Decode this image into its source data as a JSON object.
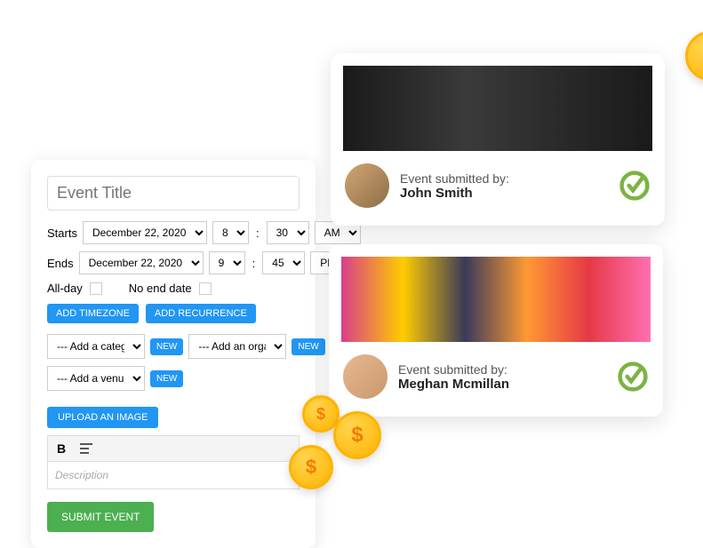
{
  "form": {
    "title_placeholder": "Event Title",
    "starts_label": "Starts",
    "ends_label": "Ends",
    "start_date": "December 22, 2020",
    "start_hour": "8",
    "start_min": "30",
    "start_ampm": "AM",
    "end_date": "December 22, 2020",
    "end_hour": "9",
    "end_min": "45",
    "end_ampm": "PM",
    "allday_label": "All-day",
    "noend_label": "No end date",
    "add_timezone": "ADD TIMEZONE",
    "add_recurrence": "ADD RECURRENCE",
    "category_placeholder": "--- Add a category",
    "organizer_placeholder": "--- Add an organizer",
    "venue_placeholder": "--- Add a venue -",
    "new_badge": "NEW",
    "upload_label": "UPLOAD AN IMAGE",
    "bold_label": "B",
    "desc_placeholder": "Description",
    "submit_label": "SUBMIT EVENT"
  },
  "cards": [
    {
      "submitted_label": "Event submitted by:",
      "name": "John Smith"
    },
    {
      "submitted_label": "Event submitted by:",
      "name": "Meghan Mcmillan"
    }
  ],
  "coin_symbol": "$"
}
